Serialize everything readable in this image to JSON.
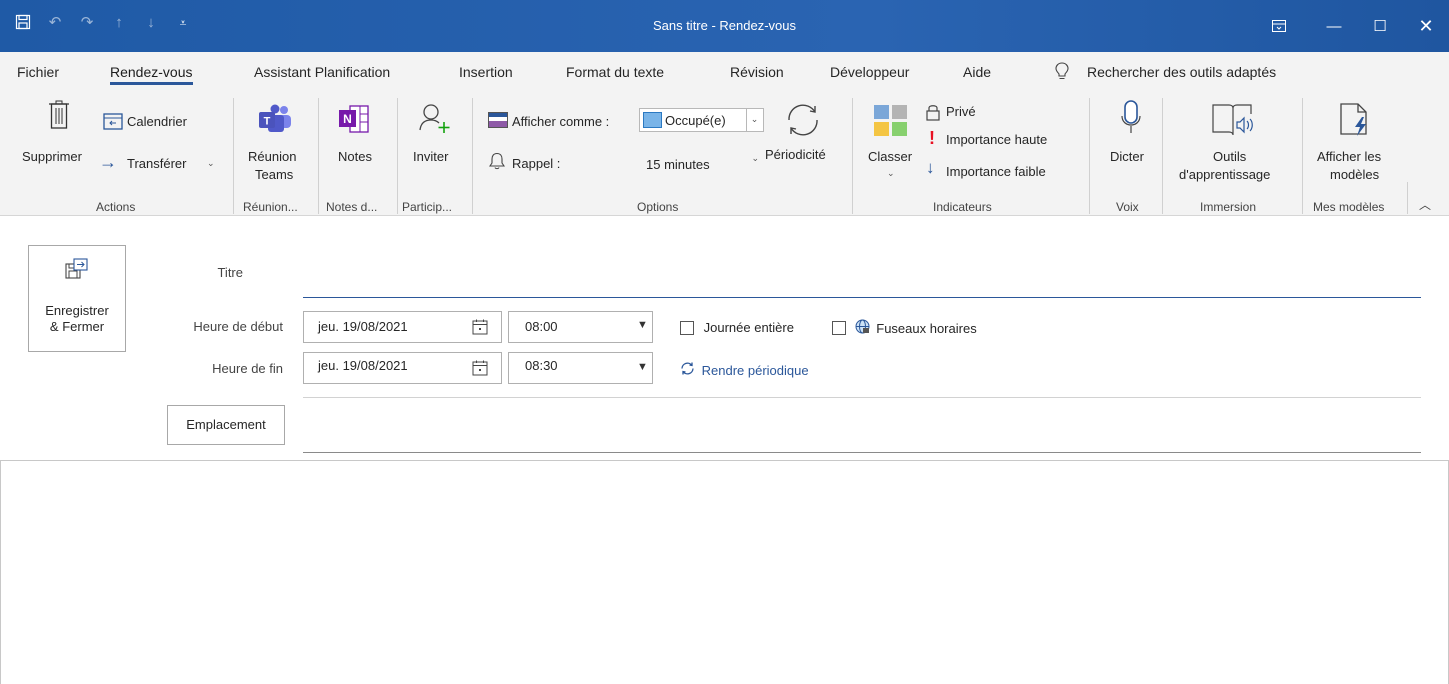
{
  "titlebar": {
    "title": "Sans titre  -  Rendez-vous",
    "qat_icons": [
      "save-icon",
      "undo-icon",
      "redo-icon",
      "up-arrow-icon",
      "down-arrow-icon",
      "customize-qat-icon"
    ],
    "accent": "#2b579a"
  },
  "tabs": [
    {
      "label": "Fichier"
    },
    {
      "label": "Rendez-vous"
    },
    {
      "label": "Assistant Planification"
    },
    {
      "label": "Insertion"
    },
    {
      "label": "Format du texte"
    },
    {
      "label": "Révision"
    },
    {
      "label": "Développeur"
    },
    {
      "label": "Aide"
    },
    {
      "label": "Rechercher des outils adaptés"
    }
  ],
  "ribbon": {
    "actions": {
      "delete_label": "Supprimer",
      "calendar_label": "Calendrier",
      "forward_label": "Transférer",
      "group_label": "Actions"
    },
    "teams": {
      "label_line1": "Réunion",
      "label_line2": "Teams",
      "group_label": "Réunion..."
    },
    "notes": {
      "label": "Notes",
      "group_label": "Notes d..."
    },
    "invite": {
      "label": "Inviter",
      "group_label": "Particip..."
    },
    "options": {
      "show_as_label": "Afficher comme :",
      "show_as_value": "Occupé(e)",
      "reminder_label": "Rappel :",
      "reminder_value": "15 minutes",
      "recurrence_label": "Périodicité",
      "group_label": "Options"
    },
    "tags": {
      "categorize_label": "Classer",
      "private_label": "Privé",
      "high_importance_label": "Importance haute",
      "low_importance_label": "Importance faible",
      "group_label": "Indicateurs"
    },
    "voice": {
      "dictate_label": "Dicter",
      "group_label": "Voix"
    },
    "immersive": {
      "label_line1": "Outils",
      "label_line2": "d'apprentissage",
      "group_label": "Immersion"
    },
    "templates": {
      "label_line1": "Afficher les",
      "label_line2": "modèles",
      "group_label": "Mes modèles"
    }
  },
  "form": {
    "save_close_line1": "Enregistrer",
    "save_close_line2": "& Fermer",
    "title_label": "Titre",
    "title_value": "",
    "start_label": "Heure de début",
    "start_date": "jeu. 19/08/2021",
    "start_time": "08:00",
    "end_label": "Heure de fin",
    "end_date": "jeu. 19/08/2021",
    "end_time": "08:30",
    "all_day_label": "Journée entière",
    "time_zones_label": "Fuseaux horaires",
    "make_recurring_label": "Rendre périodique",
    "location_button": "Emplacement",
    "location_value": ""
  }
}
